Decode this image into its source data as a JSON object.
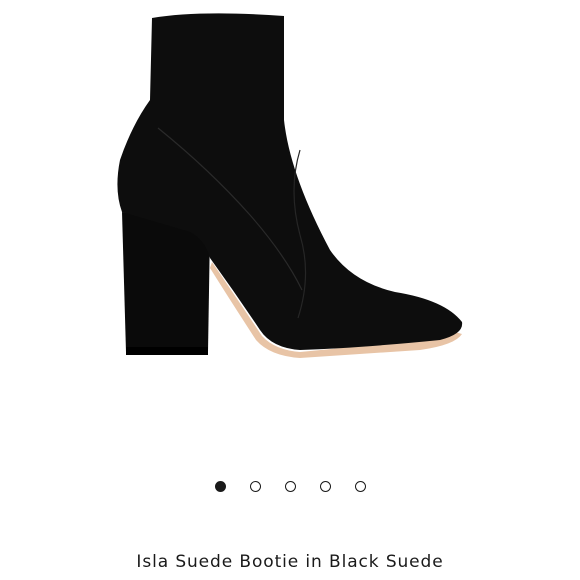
{
  "product": {
    "title": "Isla Suede Bootie in Black Suede",
    "image_subject": "black suede pointed-toe block-heel ankle bootie"
  },
  "carousel": {
    "total_slides": 5,
    "active_index": 0
  },
  "colors": {
    "suede": "#0d0d0d",
    "sole": "#e8c4a6",
    "dot": "#1a1a1a",
    "background": "#ffffff"
  }
}
